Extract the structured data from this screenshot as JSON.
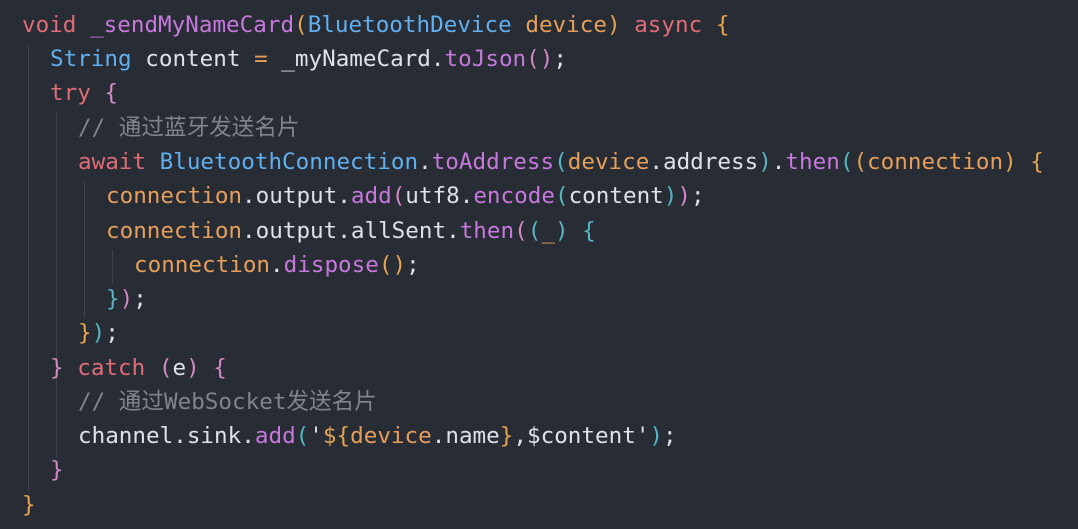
{
  "code": {
    "lines": [
      [
        {
          "t": "void",
          "c": "kw"
        },
        {
          "t": " ",
          "c": "punct"
        },
        {
          "t": "_sendMyNameCard",
          "c": "fn"
        },
        {
          "t": "(",
          "c": "brace1"
        },
        {
          "t": "BluetoothDevice",
          "c": "type"
        },
        {
          "t": " ",
          "c": "punct"
        },
        {
          "t": "device",
          "c": "param"
        },
        {
          "t": ")",
          "c": "brace1"
        },
        {
          "t": " ",
          "c": "punct"
        },
        {
          "t": "async",
          "c": "kw"
        },
        {
          "t": " ",
          "c": "punct"
        },
        {
          "t": "{",
          "c": "brace1"
        }
      ],
      [
        {
          "t": "String",
          "c": "type"
        },
        {
          "t": " ",
          "c": "punct"
        },
        {
          "t": "content",
          "c": "ident"
        },
        {
          "t": " ",
          "c": "punct"
        },
        {
          "t": "=",
          "c": "prop"
        },
        {
          "t": " ",
          "c": "punct"
        },
        {
          "t": "_myNameCard",
          "c": "ident"
        },
        {
          "t": ".",
          "c": "punct"
        },
        {
          "t": "toJson",
          "c": "fn"
        },
        {
          "t": "()",
          "c": "brace2"
        },
        {
          "t": ";",
          "c": "punct"
        }
      ],
      [
        {
          "t": "try",
          "c": "kw"
        },
        {
          "t": " ",
          "c": "punct"
        },
        {
          "t": "{",
          "c": "brace2"
        }
      ],
      [
        {
          "t": "// 通过蓝牙发送名片",
          "c": "comment"
        }
      ],
      [
        {
          "t": "await",
          "c": "kw"
        },
        {
          "t": " ",
          "c": "punct"
        },
        {
          "t": "BluetoothConnection",
          "c": "type"
        },
        {
          "t": ".",
          "c": "punct"
        },
        {
          "t": "toAddress",
          "c": "fn"
        },
        {
          "t": "(",
          "c": "brace3"
        },
        {
          "t": "device",
          "c": "prop"
        },
        {
          "t": ".",
          "c": "punct"
        },
        {
          "t": "address",
          "c": "ident"
        },
        {
          "t": ")",
          "c": "brace3"
        },
        {
          "t": ".",
          "c": "punct"
        },
        {
          "t": "then",
          "c": "fn"
        },
        {
          "t": "(",
          "c": "brace3"
        },
        {
          "t": "(",
          "c": "brace1"
        },
        {
          "t": "connection",
          "c": "param"
        },
        {
          "t": ")",
          "c": "brace1"
        },
        {
          "t": " ",
          "c": "punct"
        },
        {
          "t": "{",
          "c": "brace1"
        }
      ],
      [
        {
          "t": "connection",
          "c": "prop"
        },
        {
          "t": ".",
          "c": "punct"
        },
        {
          "t": "output",
          "c": "ident"
        },
        {
          "t": ".",
          "c": "punct"
        },
        {
          "t": "add",
          "c": "fn"
        },
        {
          "t": "(",
          "c": "brace2"
        },
        {
          "t": "utf8",
          "c": "ident"
        },
        {
          "t": ".",
          "c": "punct"
        },
        {
          "t": "encode",
          "c": "fn"
        },
        {
          "t": "(",
          "c": "brace3"
        },
        {
          "t": "content",
          "c": "ident"
        },
        {
          "t": ")",
          "c": "brace3"
        },
        {
          "t": ")",
          "c": "brace2"
        },
        {
          "t": ";",
          "c": "punct"
        }
      ],
      [
        {
          "t": "connection",
          "c": "prop"
        },
        {
          "t": ".",
          "c": "punct"
        },
        {
          "t": "output",
          "c": "ident"
        },
        {
          "t": ".",
          "c": "punct"
        },
        {
          "t": "allSent",
          "c": "ident"
        },
        {
          "t": ".",
          "c": "punct"
        },
        {
          "t": "then",
          "c": "fn"
        },
        {
          "t": "(",
          "c": "brace2"
        },
        {
          "t": "(",
          "c": "brace3"
        },
        {
          "t": "_",
          "c": "param"
        },
        {
          "t": ")",
          "c": "brace3"
        },
        {
          "t": " ",
          "c": "punct"
        },
        {
          "t": "{",
          "c": "brace3"
        }
      ],
      [
        {
          "t": "connection",
          "c": "prop"
        },
        {
          "t": ".",
          "c": "punct"
        },
        {
          "t": "dispose",
          "c": "fn"
        },
        {
          "t": "()",
          "c": "brace1"
        },
        {
          "t": ";",
          "c": "punct"
        }
      ],
      [
        {
          "t": "}",
          "c": "brace3"
        },
        {
          "t": ")",
          "c": "brace2"
        },
        {
          "t": ";",
          "c": "punct"
        }
      ],
      [
        {
          "t": "}",
          "c": "brace1"
        },
        {
          "t": ")",
          "c": "brace3"
        },
        {
          "t": ";",
          "c": "punct"
        }
      ],
      [
        {
          "t": "}",
          "c": "brace2"
        },
        {
          "t": " ",
          "c": "punct"
        },
        {
          "t": "catch",
          "c": "kw"
        },
        {
          "t": " ",
          "c": "punct"
        },
        {
          "t": "(",
          "c": "brace2"
        },
        {
          "t": "e",
          "c": "ident"
        },
        {
          "t": ")",
          "c": "brace2"
        },
        {
          "t": " ",
          "c": "punct"
        },
        {
          "t": "{",
          "c": "brace2"
        }
      ],
      [
        {
          "t": "// 通过WebSocket发送名片",
          "c": "comment"
        }
      ],
      [
        {
          "t": "channel",
          "c": "ident"
        },
        {
          "t": ".",
          "c": "punct"
        },
        {
          "t": "sink",
          "c": "ident"
        },
        {
          "t": ".",
          "c": "punct"
        },
        {
          "t": "add",
          "c": "fn"
        },
        {
          "t": "(",
          "c": "brace3"
        },
        {
          "t": "'",
          "c": "ident"
        },
        {
          "t": "${",
          "c": "brace1"
        },
        {
          "t": "device",
          "c": "prop"
        },
        {
          "t": ".",
          "c": "punct"
        },
        {
          "t": "name",
          "c": "ident"
        },
        {
          "t": "}",
          "c": "brace1"
        },
        {
          "t": ",",
          "c": "ident"
        },
        {
          "t": "$content",
          "c": "ident"
        },
        {
          "t": "'",
          "c": "ident"
        },
        {
          "t": ")",
          "c": "brace3"
        },
        {
          "t": ";",
          "c": "punct"
        }
      ],
      [
        {
          "t": "}",
          "c": "brace2"
        }
      ],
      [
        {
          "t": "}",
          "c": "brace1"
        }
      ]
    ]
  }
}
